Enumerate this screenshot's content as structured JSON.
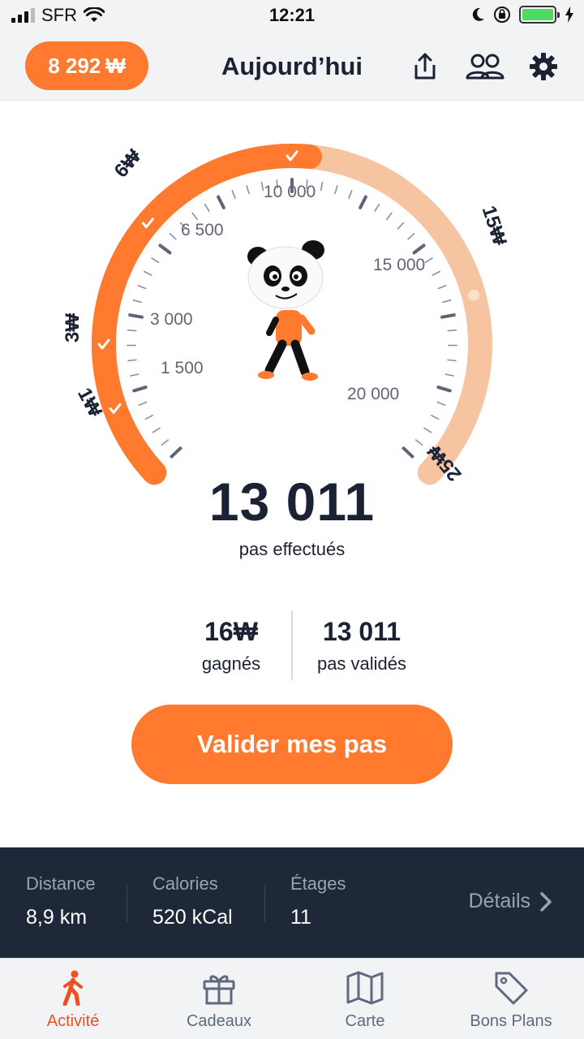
{
  "status_bar": {
    "carrier": "SFR",
    "time": "12:21"
  },
  "header": {
    "coins": "8 292",
    "coin_symbol": "₩",
    "title": "Aujourd’hui"
  },
  "gauge": {
    "current_steps": 13011,
    "max_steps": 25000,
    "scale_labels": [
      "1 500",
      "3 000",
      "6 500",
      "10 000",
      "15 000",
      "20 000"
    ],
    "milestones": [
      "1₩",
      "3₩",
      "6₩",
      "15₩",
      "25₩"
    ]
  },
  "steps": {
    "count": "13 011",
    "label": "pas effectués"
  },
  "stats": {
    "earned_value": "16",
    "earned_label": "gagnés",
    "validated_value": "13 011",
    "validated_label": "pas validés"
  },
  "cta": {
    "label": "Valider mes pas"
  },
  "panel": {
    "distance_label": "Distance",
    "distance_value": "8,9 km",
    "calories_label": "Calories",
    "calories_value": "520 kCal",
    "floors_label": "Étages",
    "floors_value": "11",
    "details_label": "Détails"
  },
  "tabs": [
    {
      "label": "Activité"
    },
    {
      "label": "Cadeaux"
    },
    {
      "label": "Carte"
    },
    {
      "label": "Bons Plans"
    }
  ],
  "colors": {
    "accent": "#ff7a2e",
    "accent_light": "#f7c4a1",
    "dark": "#1e2838",
    "active_tab": "#ef4f1c"
  }
}
